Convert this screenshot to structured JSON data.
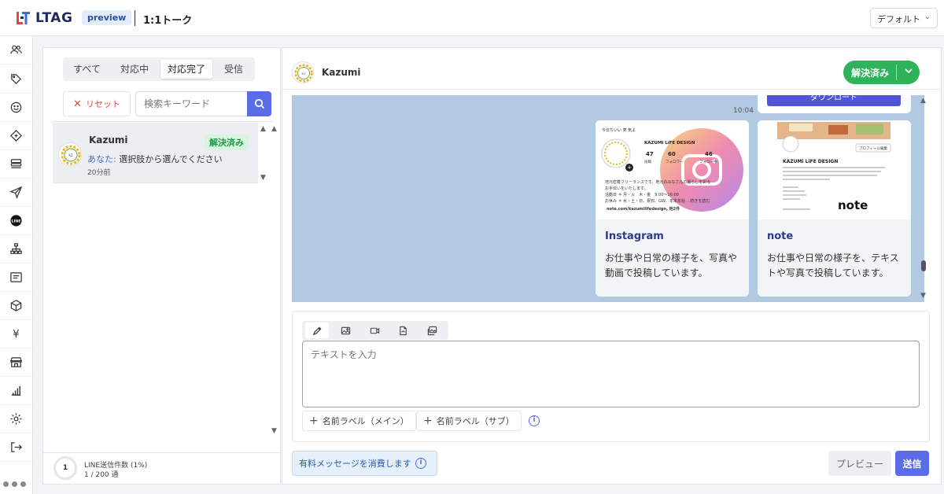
{
  "header": {
    "app_name": "LTAG",
    "preview_badge": "preview",
    "page_title": "1:1トーク",
    "view_select": "デフォルト"
  },
  "sidebar": {
    "items": [
      {
        "icon": "users-icon"
      },
      {
        "icon": "tag-icon"
      },
      {
        "icon": "smiley-icon"
      },
      {
        "icon": "ticket-icon"
      },
      {
        "icon": "list-icon"
      },
      {
        "icon": "send-icon"
      },
      {
        "icon": "line-icon",
        "label": "LINE"
      },
      {
        "icon": "sitemap-icon"
      },
      {
        "icon": "message-icon"
      },
      {
        "icon": "package-icon"
      },
      {
        "icon": "yen-icon",
        "label": "¥"
      },
      {
        "icon": "store-icon"
      },
      {
        "icon": "chart-icon"
      },
      {
        "icon": "gear-icon"
      },
      {
        "icon": "logout-icon"
      }
    ]
  },
  "left_panel": {
    "tabs": [
      "すべて",
      "対応中",
      "対応完了",
      "受信"
    ],
    "active_tab": "対応完了",
    "reset_label": "リセット",
    "search_placeholder": "検索キーワード",
    "conversations": [
      {
        "name": "Kazumi",
        "status": "解決済み",
        "sender": "あなた:",
        "preview": " 選択肢から選んでください",
        "time": "20分前"
      }
    ],
    "quota": {
      "count": "1",
      "label": "LINE送信件数 (1%)",
      "value": "1 / 200 通",
      "fraction": 0.01
    }
  },
  "chat": {
    "contact_name": "Kazumi",
    "status_button": "解決済み",
    "download_label": "ダウンロード",
    "message_time": "10:04",
    "cards": [
      {
        "title": "Instagram",
        "description": "お仕事や日常の様子を、写真や動画で投稿しています。",
        "profile": {
          "tagline": "今日ちいい 笑 気よ",
          "brand": "KAZUMi LiFE DESIGN",
          "stats": [
            {
              "value": "47",
              "label": "投稿"
            },
            {
              "value": "60",
              "label": "フォロワー"
            },
            {
              "value": "46",
              "label": "フォロー中"
            }
          ],
          "bio1": "地元密着フリーランスです。地元のみなさんの暮らしを彩る",
          "bio2": "お手伝いをいたします。",
          "bio3": "活動日 ＊ 月・火　木・金　9:00〜16:00",
          "bio4": "お休み ＊ 水・土・日、祝日、GW、年末年始 ...続きを読む",
          "link": "note.com/kazumilifedesign, 他2件"
        }
      },
      {
        "title": "note",
        "description": "お仕事や日常の様子を、テキストや写真で投稿しています。",
        "profile": {
          "edit_button": "プロフィール編集",
          "brand": "KAZUMi LiFE DESIGN",
          "logo": "note"
        }
      }
    ],
    "compose": {
      "placeholder": "テキストを入力",
      "name_label_main": "名前ラベル（メイン）",
      "name_label_sub": "名前ラベル（サブ）"
    },
    "paid_notice": "有料メッセージを消費します",
    "preview_button": "プレビュー",
    "send_button": "送信"
  },
  "colors": {
    "accent": "#5a6ce8",
    "success": "#2fb35a",
    "chat_bg": "#b2c9e2",
    "danger": "#e04848"
  }
}
